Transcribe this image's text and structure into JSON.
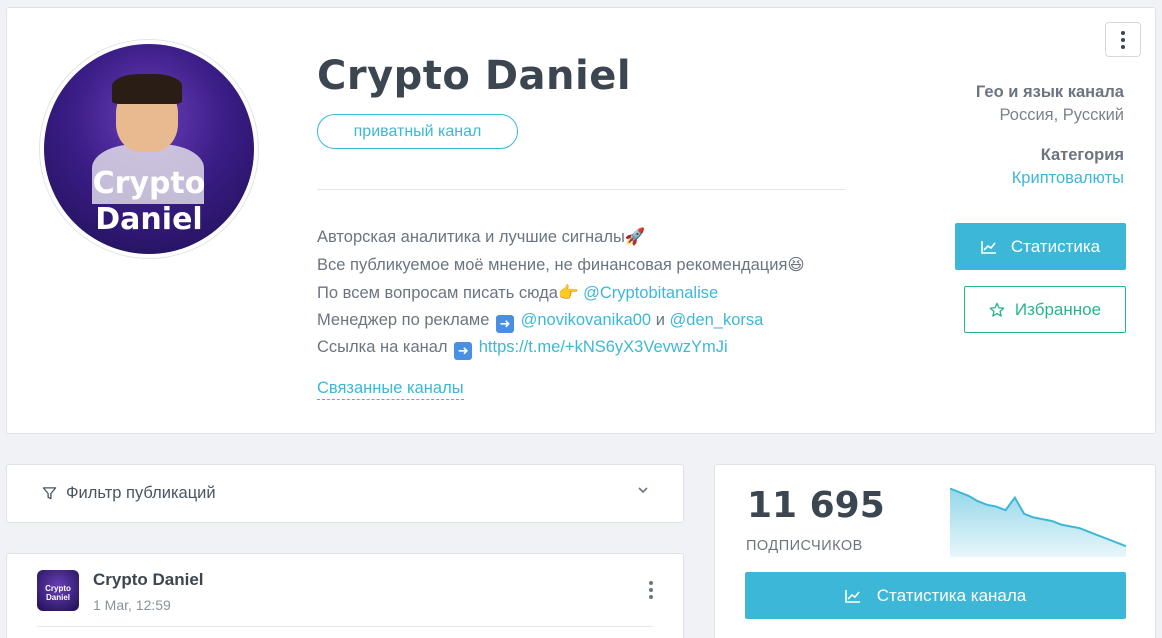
{
  "channel": {
    "avatar_text_line1": "Crypto",
    "avatar_text_line2": "Daniel",
    "title": "Crypto Daniel",
    "type_badge": "приватный канал",
    "description": {
      "line1": "Авторская аналитика и лучшие сигналы",
      "line1_emoji": "🚀",
      "line2": "Все публикуемое моё мнение, не финансовая рекомендация",
      "line2_emoji": "😆",
      "line3": "По всем вопросам писать сюда",
      "line3_emoji": "👉",
      "line3_link": "@Cryptobitanalise",
      "line4": "Менеджер по рекламе",
      "line4_link1": "@novikovanika00",
      "line4_and": "и",
      "line4_link2": "@den_korsa",
      "line5": "Ссылка на канал",
      "line5_link": "https://t.me/+kNS6yX3VevwzYmJi"
    },
    "related_label": "Связанные каналы"
  },
  "info": {
    "geo_label": "Гео и язык канала",
    "geo_value": "Россия, Русский",
    "category_label": "Категория",
    "category_value": "Криптовалюты"
  },
  "actions": {
    "stats_label": "Статистика",
    "favorite_label": "Избранное",
    "stats_icon": "chart-line-icon",
    "favorite_icon": "star-icon"
  },
  "filter": {
    "label": "Фильтр публикаций"
  },
  "post": {
    "author": "Crypto Daniel",
    "date": "1 Mar, 12:59"
  },
  "subscribers": {
    "count": "11 695",
    "label": "ПОДПИСЧИКОВ",
    "button_label": "Статистика канала",
    "trend": [
      100,
      98,
      96,
      93,
      91,
      90,
      88,
      95,
      86,
      84,
      83,
      82,
      80,
      79,
      78,
      76,
      74,
      72,
      70,
      68
    ]
  },
  "colors": {
    "accent": "#3db7d7",
    "favorite": "#28b48c"
  }
}
